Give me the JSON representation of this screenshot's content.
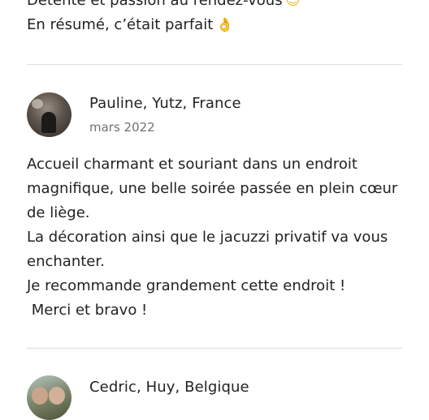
{
  "previous_review": {
    "lines": [
      "Détente et passion au rendez-vous",
      "En résumé, c’était parfait"
    ],
    "emojis": [
      "winking-face-emoji",
      "ok-hand-emoji"
    ]
  },
  "reviews": [
    {
      "author": "Pauline, Yutz, France",
      "date": "mars 2022",
      "lines": [
        "Accueil charmant et souriant dans un endroit",
        "magnifique, une belle soirée passée en plein cœur",
        "de liège.",
        "La décoration ainsi que le jacuzzi privatif va vous",
        "enchanter.",
        "Je recommande grandement cette endroit !",
        " Merci et bravo !"
      ]
    },
    {
      "author": "Cedric, Huy, Belgique"
    }
  ]
}
